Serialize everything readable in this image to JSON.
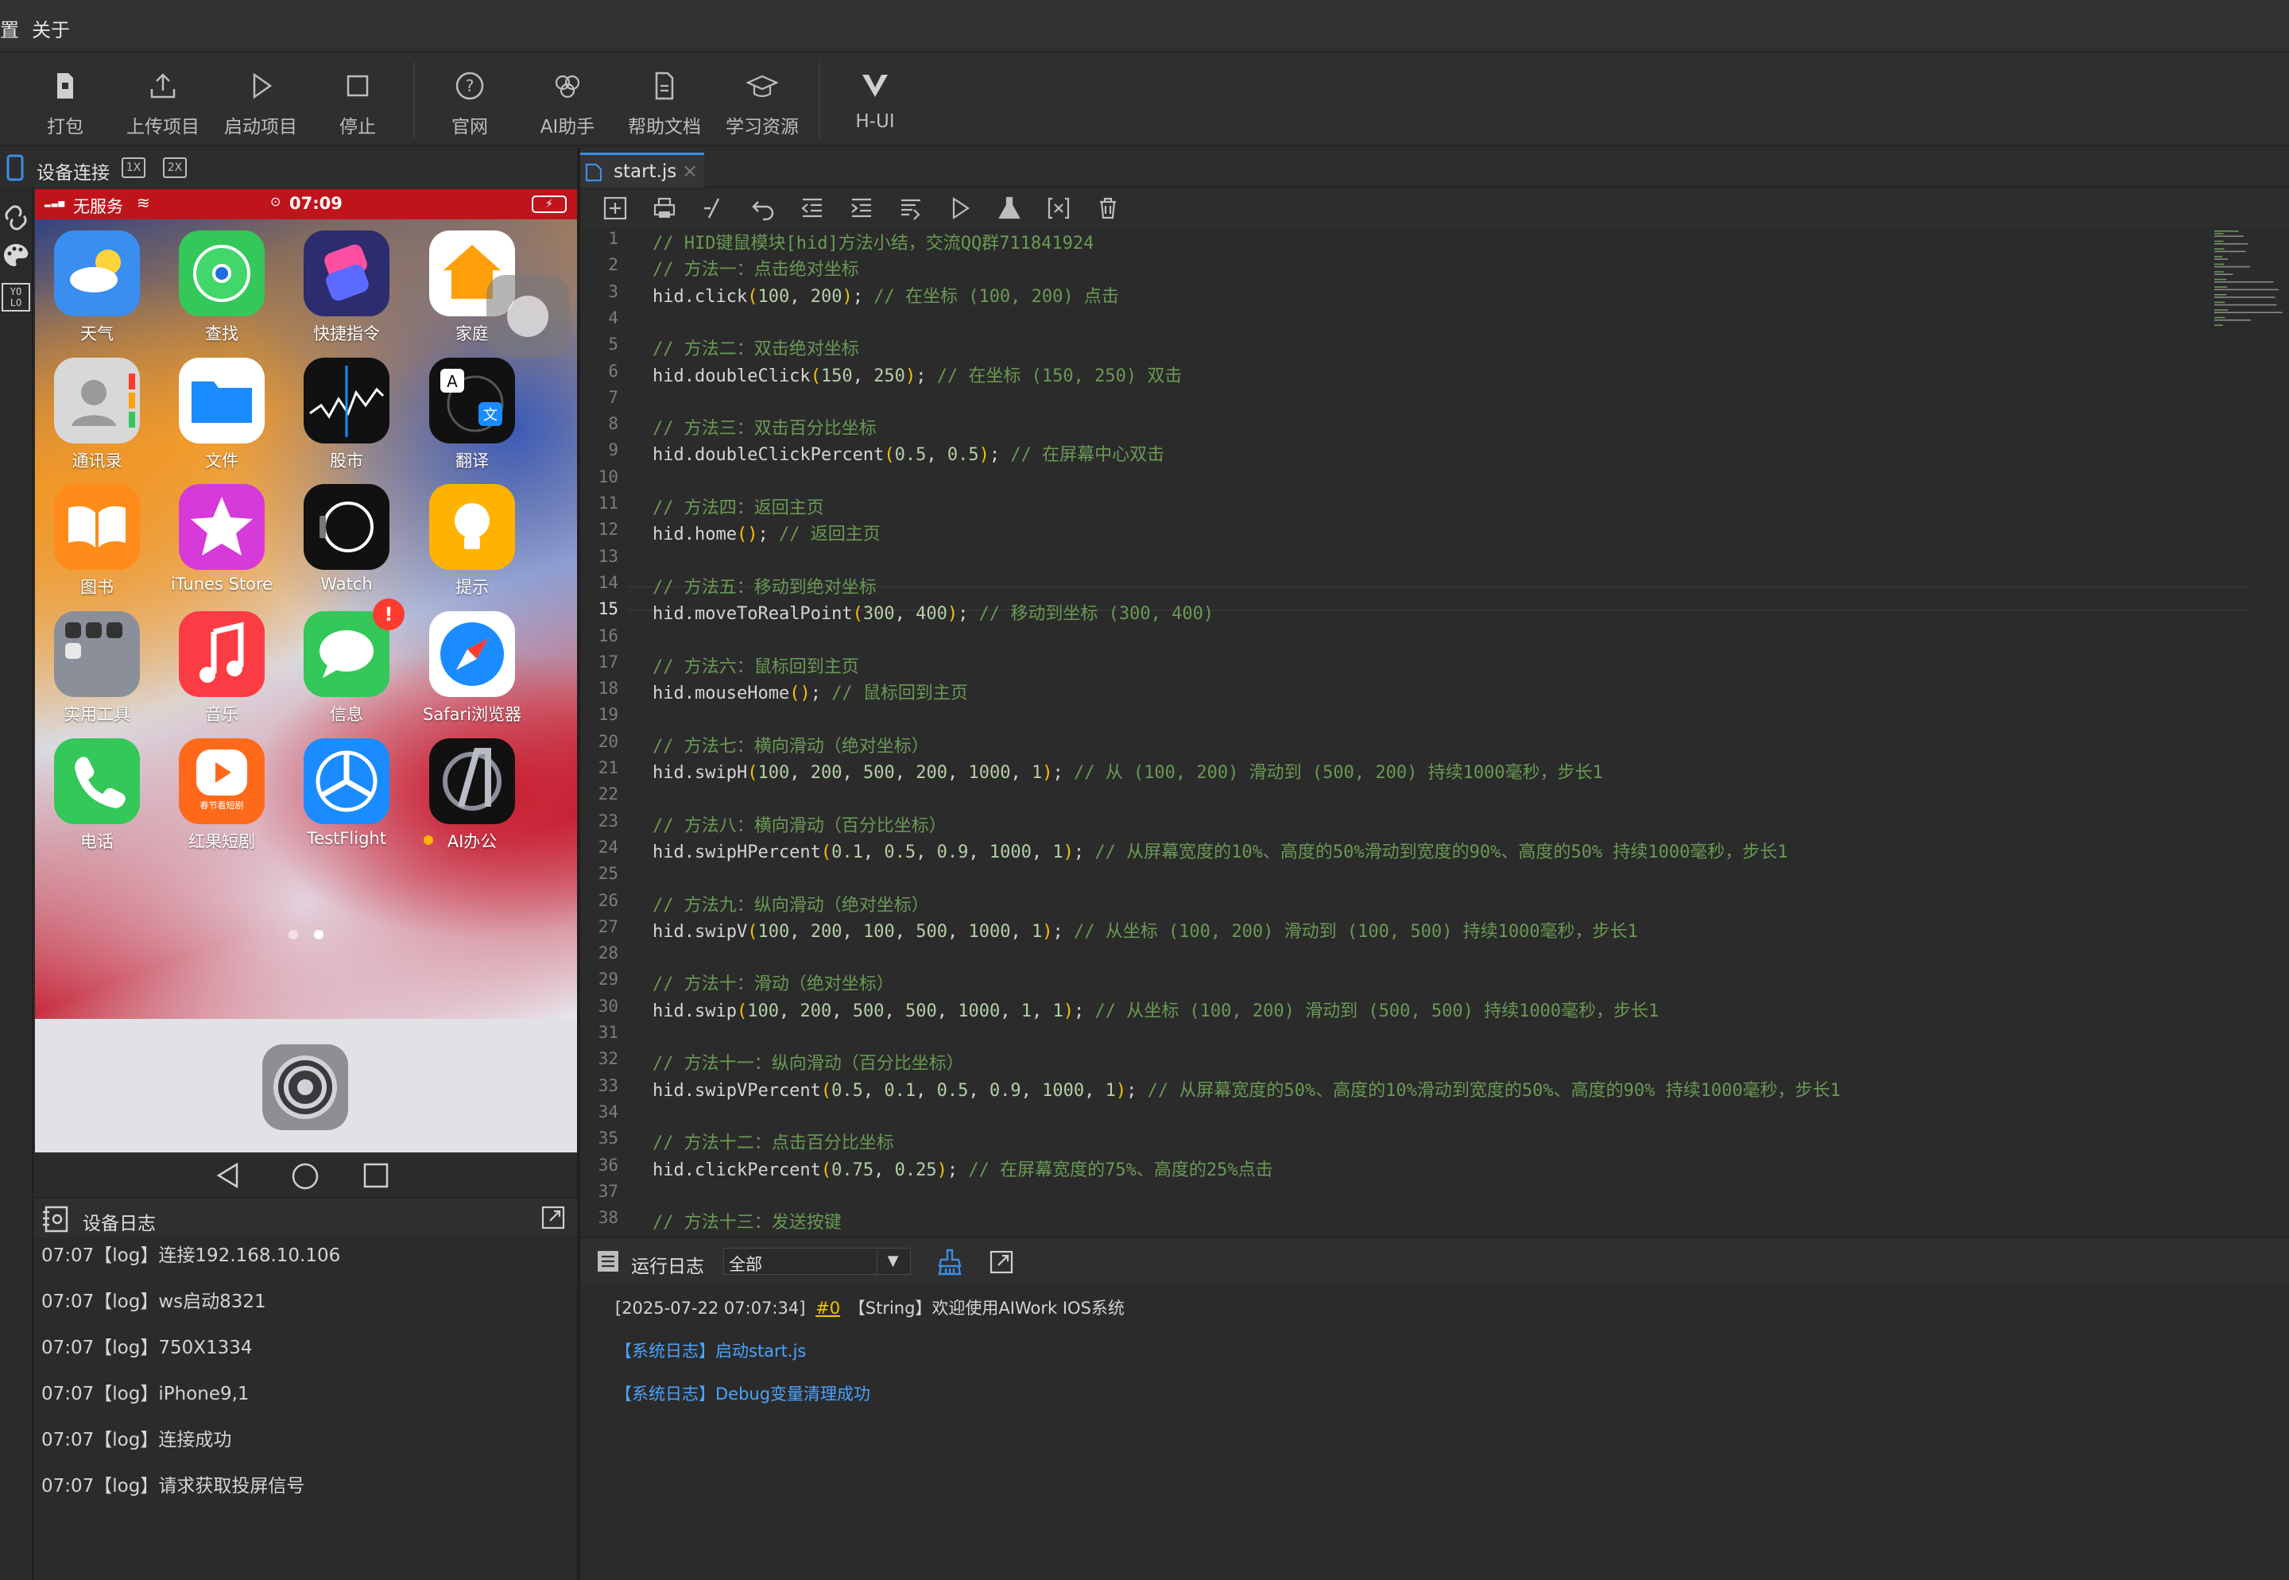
{
  "menu": {
    "items": [
      "置",
      "关于"
    ]
  },
  "toolbar": {
    "buttons": [
      {
        "label": "打包",
        "icon": "package-icon"
      },
      {
        "label": "上传项目",
        "icon": "upload-icon"
      },
      {
        "label": "启动项目",
        "icon": "play-icon"
      },
      {
        "label": "停止",
        "icon": "stop-icon"
      },
      {
        "label": "官网",
        "icon": "help-circle-icon"
      },
      {
        "label": "AI助手",
        "icon": "ai-knot-icon"
      },
      {
        "label": "帮助文档",
        "icon": "document-icon"
      },
      {
        "label": "学习资源",
        "icon": "graduation-cap-icon"
      },
      {
        "label": "H-UI",
        "icon": "v-logo-icon"
      }
    ]
  },
  "device_panel": {
    "tab_label": "设备连接",
    "zoom_1x": "1X",
    "zoom_2x": "2X",
    "rail_yolo": "YO LO"
  },
  "phone": {
    "status": {
      "carrier": "无服务",
      "time": "07:09"
    },
    "apps": [
      {
        "label": "天气"
      },
      {
        "label": "查找"
      },
      {
        "label": "快捷指令"
      },
      {
        "label": "家庭"
      },
      {
        "label": "通讯录"
      },
      {
        "label": "文件"
      },
      {
        "label": "股市"
      },
      {
        "label": "翻译"
      },
      {
        "label": "图书"
      },
      {
        "label": "iTunes Store"
      },
      {
        "label": "Watch"
      },
      {
        "label": "提示"
      },
      {
        "label": "实用工具"
      },
      {
        "label": "音乐"
      },
      {
        "label": "信息",
        "badge": "!"
      },
      {
        "label": "Safari浏览器"
      },
      {
        "label": "电话"
      },
      {
        "label": "红果短剧",
        "icon_text": "春节看短剧"
      },
      {
        "label": "TestFlight"
      },
      {
        "label": "AI办公"
      }
    ]
  },
  "device_log": {
    "title": "设备日志",
    "lines": [
      "07:07【log】连接192.168.10.106",
      "07:07【log】ws启动8321",
      "07:07【log】750X1334",
      "07:07【log】iPhone9,1",
      "07:07【log】连接成功",
      "07:07【log】请求获取投屏信号"
    ]
  },
  "editor": {
    "tab": "start.js",
    "code": [
      "// HID键鼠模块[hid]方法小结，交流QQ群711841924",
      "// 方法一：点击绝对坐标",
      "hid.click(100, 200); // 在坐标 (100, 200) 点击",
      "",
      "// 方法二：双击绝对坐标",
      "hid.doubleClick(150, 250); // 在坐标 (150, 250) 双击",
      "",
      "// 方法三：双击百分比坐标",
      "hid.doubleClickPercent(0.5, 0.5); // 在屏幕中心双击",
      "",
      "// 方法四：返回主页",
      "hid.home(); // 返回主页",
      "",
      "// 方法五：移动到绝对坐标",
      "hid.moveToRealPoint(300, 400); // 移动到坐标 (300, 400)",
      "",
      "// 方法六：鼠标回到主页",
      "hid.mouseHome(); // 鼠标回到主页",
      "",
      "// 方法七：横向滑动（绝对坐标）",
      "hid.swipH(100, 200, 500, 200, 1000, 1); // 从 (100, 200) 滑动到 (500, 200) 持续1000毫秒，步长1",
      "",
      "// 方法八：横向滑动（百分比坐标）",
      "hid.swipHPercent(0.1, 0.5, 0.9, 1000, 1); // 从屏幕宽度的10%、高度的50%滑动到宽度的90%、高度的50% 持续1000毫秒，步长1",
      "",
      "// 方法九：纵向滑动（绝对坐标）",
      "hid.swipV(100, 200, 100, 500, 1000, 1); // 从坐标 (100, 200) 滑动到 (100, 500) 持续1000毫秒，步长1",
      "",
      "// 方法十：滑动（绝对坐标）",
      "hid.swip(100, 200, 500, 500, 1000, 1, 1); // 从坐标 (100, 200) 滑动到 (500, 500) 持续1000毫秒，步长1",
      "",
      "// 方法十一：纵向滑动（百分比坐标）",
      "hid.swipVPercent(0.5, 0.1, 0.5, 0.9, 1000, 1); // 从屏幕宽度的50%、高度的10%滑动到宽度的50%、高度的90% 持续1000毫秒，步长1",
      "",
      "// 方法十二：点击百分比坐标",
      "hid.clickPercent(0.75, 0.25); // 在屏幕宽度的75%、高度的25%点击",
      "",
      "// 方法十三：发送按键"
    ],
    "current_line": 15
  },
  "run_log": {
    "title": "运行日志",
    "filter_value": "全部",
    "line1_prefix": "[2025-07-22 07:07:34]",
    "line1_tag": "#0",
    "line1_text": "【String】欢迎使用AIWork IOS系统",
    "line2": "【系统日志】启动start.js",
    "line3": "【系统日志】Debug变量清理成功"
  },
  "colors": {
    "accent": "#3b8ee6",
    "comment": "#6a9955",
    "paren": "#f5c400",
    "number": "#b5cea8",
    "status_red": "#c0141c"
  }
}
